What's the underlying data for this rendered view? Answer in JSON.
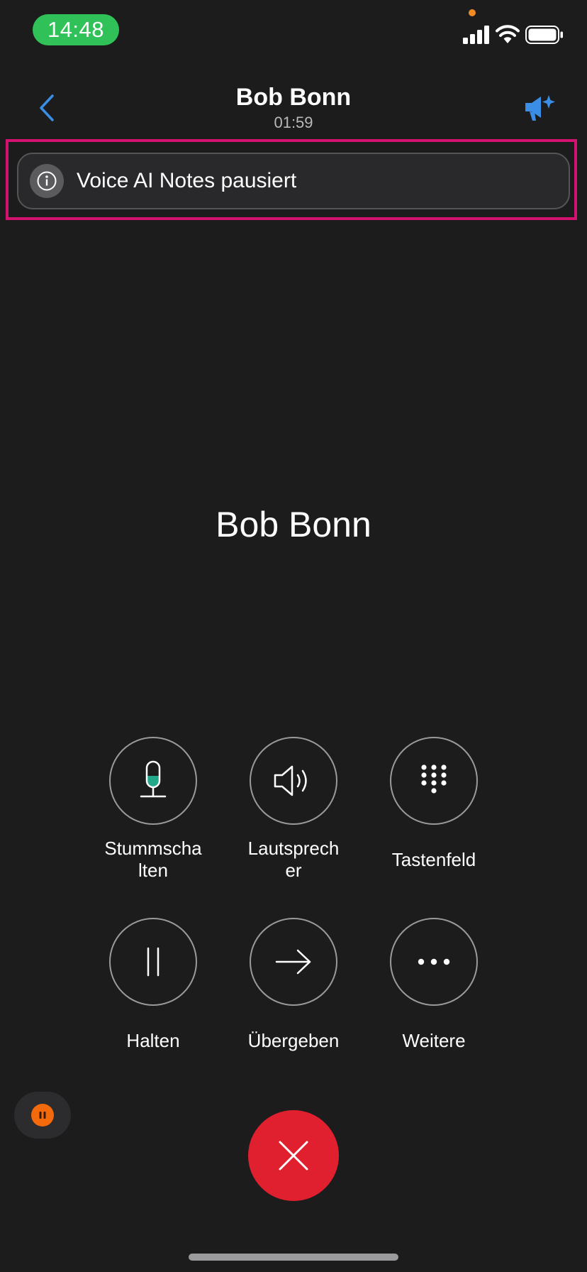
{
  "status_bar": {
    "time": "14:48"
  },
  "header": {
    "contact_name": "Bob Bonn",
    "duration": "01:59",
    "accent_color": "#3a8ee6"
  },
  "banner": {
    "icon": "info-icon",
    "text": "Voice AI Notes pausiert"
  },
  "caller": {
    "name": "Bob Bonn"
  },
  "controls": [
    {
      "label": "Stummscha\nlten",
      "icon": "microphone-icon"
    },
    {
      "label": "Lautsprech\ner",
      "icon": "speaker-icon"
    },
    {
      "label": "Tastenfeld",
      "icon": "keypad-icon"
    },
    {
      "label": "Halten",
      "icon": "pause-icon"
    },
    {
      "label": "Übergeben",
      "icon": "arrow-right-icon"
    },
    {
      "label": "Weitere",
      "icon": "more-icon"
    }
  ],
  "end_call": {
    "icon": "close-icon",
    "color": "#e0202f"
  },
  "pause_indicator": {
    "icon": "pause-icon",
    "color": "#f26a0c"
  }
}
